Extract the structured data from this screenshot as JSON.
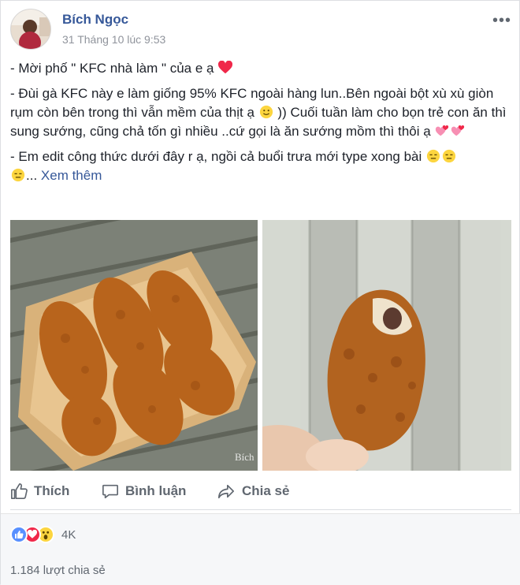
{
  "post": {
    "author": "Bích Ngọc",
    "timestamp": "31 Tháng 10 lúc 9:53",
    "more_label": "•••",
    "paragraphs": {
      "p1": "- Mời phố \" KFC nhà làm \" của e ạ",
      "p2a": "- Đùi gà KFC này e làm giống 95% KFC ngoài hàng lun..Bên ngoài bột xù xù giòn rụm còn bên trong thì vẫn mềm của thịt ạ",
      "p2b": ")) Cuối tuần làm cho bọn trẻ con ăn thì sung sướng, cũng chả tốn gì nhiều ..cứ gọi là ăn sướng mồm thì thôi ạ",
      "p3": "- Em edit công thức dưới đây r ạ, ngồi cả buổi trưa mới type xong bài",
      "p3_tail": "..."
    },
    "see_more": "Xem thêm",
    "photo_watermark": "Bích",
    "emojis": [
      "heart-emoji",
      "smile-emoji",
      "sparkling-hearts-emoji",
      "expressionless-emoji"
    ],
    "colors": {
      "link": "#365899",
      "heart": "#f0284a",
      "like_blue": "#5890ff",
      "wow_yellow": "#fcd53f"
    }
  },
  "actions": {
    "like": "Thích",
    "comment": "Bình luận",
    "share": "Chia sẻ"
  },
  "reactions": {
    "icons": [
      "like-reaction-icon",
      "love-reaction-icon",
      "wow-reaction-icon"
    ],
    "count": "4K"
  },
  "shares": "1.184 lượt chia sẻ"
}
